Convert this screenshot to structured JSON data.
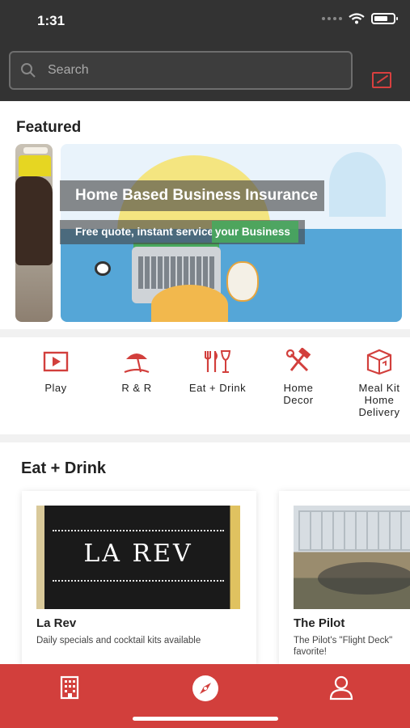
{
  "status_bar": {
    "time": "1:31"
  },
  "search": {
    "placeholder": "Search"
  },
  "featured": {
    "title": "Featured",
    "banner": {
      "title": "Home Based Business Insurance",
      "subtitle_left": "Free quote, instant service",
      "subtitle_right": " your Business"
    }
  },
  "categories": [
    {
      "label": "Play",
      "icon": "play-icon"
    },
    {
      "label": "R & R",
      "icon": "beach-umbrella-icon"
    },
    {
      "label": "Eat + Drink",
      "icon": "utensils-drink-icon"
    },
    {
      "label": "Home\nDecor",
      "icon": "hammer-wrench-icon"
    },
    {
      "label": "Meal Kit\nHome\nDelivery",
      "icon": "box-icon"
    }
  ],
  "eat_drink": {
    "title": "Eat + Drink",
    "items": [
      {
        "name": "La Rev",
        "logo_text": "LA REV",
        "description": "Daily specials and cocktail kits available"
      },
      {
        "name": "The Pilot",
        "description": "The Pilot's \"Flight Deck\" favorite!"
      }
    ]
  },
  "tabbar": {
    "tabs": [
      {
        "icon": "building-icon"
      },
      {
        "icon": "compass-icon"
      },
      {
        "icon": "user-icon"
      }
    ]
  },
  "colors": {
    "accent": "#d23f3c",
    "header": "#333333"
  }
}
